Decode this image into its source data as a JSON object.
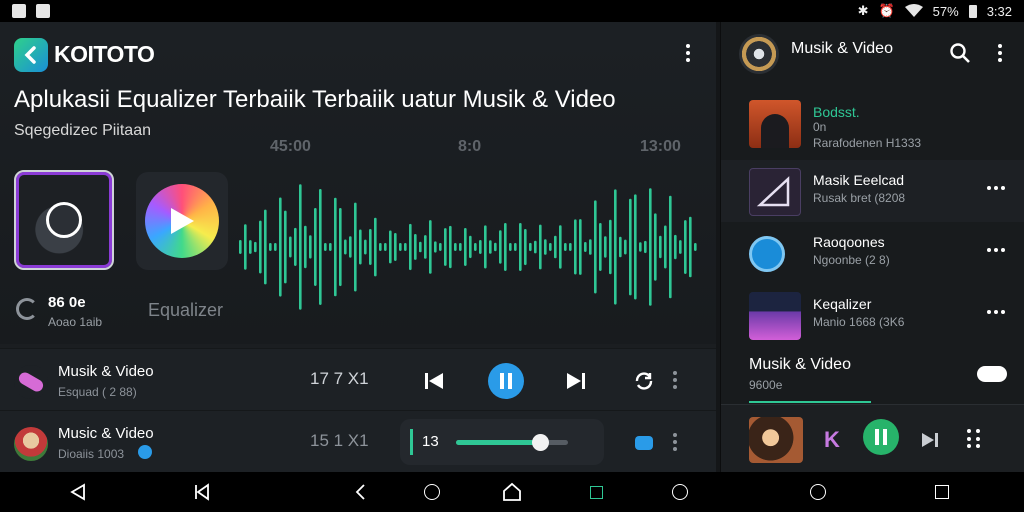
{
  "statusbar": {
    "battery": "57%",
    "time": "3:32"
  },
  "app": {
    "brand": "KOITOTO"
  },
  "hero": {
    "headline": "Aplukasii Equalizer Terbaiik Terbaiik uatur Musik & Video",
    "subtitle": "Sqegedizec Piitaan",
    "ticks": [
      "45:00",
      "8:0",
      "13:00"
    ],
    "info_value": "86 0e",
    "info_caption": "Aoao 1aib",
    "eq_label": "Equalizer"
  },
  "rows": [
    {
      "title": "Musik & Video",
      "subtitle": "Esquad ( 2 88)",
      "number": "17 7 X1"
    },
    {
      "title": "Music & Video",
      "subtitle": "Dioaiis 1003",
      "number": "15 1 X1",
      "slider_value": "13",
      "slider_progress": 0.75
    }
  ],
  "sidebar": {
    "title": "Musik & Video",
    "items": [
      {
        "title": "Bodsst.",
        "line2": "0n",
        "line3": "Rarafodenen H1333",
        "thumb_color": "#d0562b"
      },
      {
        "title": "Masik Eeelcad",
        "subtitle": "Rusak bret (8208",
        "thumb_color": "#2a2335"
      },
      {
        "title": "Raoqoones",
        "subtitle": "Ngoonbe (2 8)",
        "thumb_color": "#1a8cd8"
      },
      {
        "title": "Keqalizer",
        "subtitle": "Manio 1668 (3K6",
        "thumb_color": "#3a2f5a"
      }
    ],
    "section_title": "Musik & Video",
    "section_sub": "9600e"
  },
  "colors": {
    "accent": "#2a9be8",
    "wave": "#2fc795",
    "play_green": "#27b36a"
  }
}
